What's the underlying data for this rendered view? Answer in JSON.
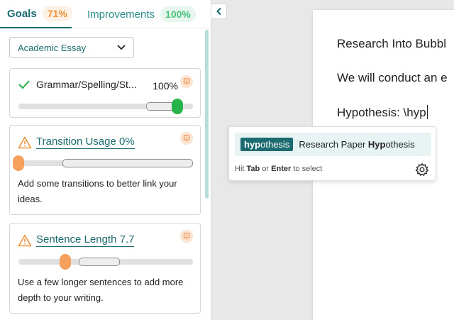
{
  "tabs": {
    "goals_label": "Goals",
    "goals_pct": "71%",
    "improvements_label": "Improvements",
    "improvements_pct": "100%"
  },
  "dropdown": {
    "value": "Academic Essay"
  },
  "cards": {
    "grammar": {
      "title": "Grammar/Spelling/St...",
      "score": "100%",
      "level": 1.0
    },
    "transition": {
      "title": "Transition Usage 0%",
      "level": 0.0,
      "desc": "Add some transitions to better link your ideas."
    },
    "sentence": {
      "title": "Sentence Length 7.7",
      "level": 0.23,
      "desc": "Use a few longer sentences to add more depth to your writing."
    }
  },
  "document": {
    "line1": "Research Into Bubbl",
    "line2": "We will conduct an e",
    "line3": "Hypothesis: \\hyp"
  },
  "autocomplete": {
    "tag_match": "hyp",
    "tag_rest": "othesis",
    "text_pre": "Research Paper ",
    "text_match": "Hyp",
    "text_post": "othesis",
    "hint_pre": "Hit ",
    "hint_key1": "Tab",
    "hint_mid": " or ",
    "hint_key2": "Enter",
    "hint_post": " to select"
  },
  "colors": {
    "teal": "#1c6b70",
    "orange": "#f0923a",
    "green": "#27b24a"
  }
}
